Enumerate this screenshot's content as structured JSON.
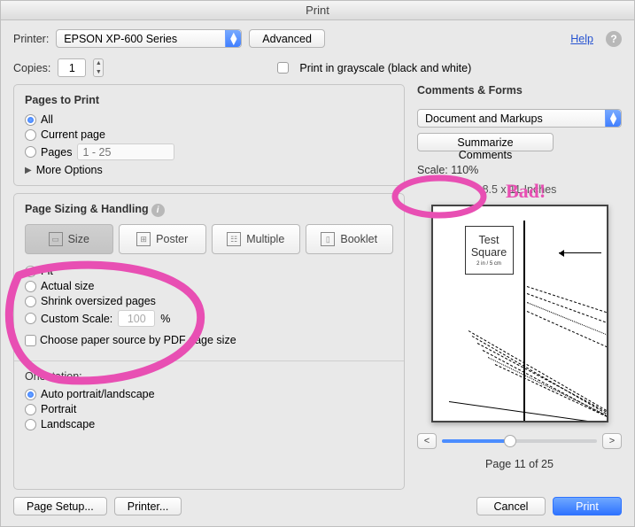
{
  "title": "Print",
  "header": {
    "printer_label": "Printer:",
    "printer_value": "EPSON XP-600 Series",
    "advanced": "Advanced",
    "help": "Help",
    "copies_label": "Copies:",
    "copies_value": "1",
    "grayscale_label": "Print in grayscale (black and white)"
  },
  "pages": {
    "title": "Pages to Print",
    "all": "All",
    "current": "Current page",
    "pages": "Pages",
    "range_placeholder": "1 - 25",
    "more": "More Options"
  },
  "sizing": {
    "title": "Page Sizing & Handling",
    "tabs": {
      "size": "Size",
      "poster": "Poster",
      "multiple": "Multiple",
      "booklet": "Booklet"
    },
    "fit": "Fit",
    "actual": "Actual size",
    "shrink": "Shrink oversized pages",
    "custom": "Custom Scale:",
    "custom_value": "100",
    "percent": "%",
    "choose_source": "Choose paper source by PDF page size"
  },
  "orientation": {
    "title": "Orientation:",
    "auto": "Auto portrait/landscape",
    "portrait": "Portrait",
    "landscape": "Landscape"
  },
  "comments": {
    "title": "Comments & Forms",
    "selected": "Document and Markups",
    "summarize": "Summarize Comments"
  },
  "preview": {
    "scale_label": "Scale: 110%",
    "dims": "8.5 x 11 Inches",
    "test_sq_top": "Test",
    "test_sq_mid": "Square",
    "test_sq_bot": "2 in / 5 cm",
    "page_indicator": "Page 11 of 25"
  },
  "footer": {
    "page_setup": "Page Setup...",
    "printer": "Printer...",
    "cancel": "Cancel",
    "print": "Print"
  },
  "annotation": "Bad!"
}
